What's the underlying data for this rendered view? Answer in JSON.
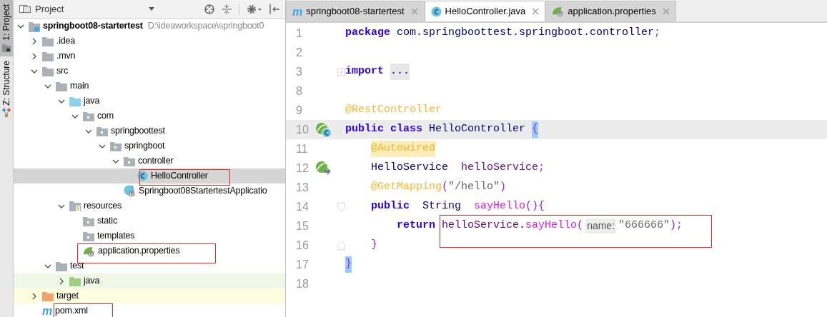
{
  "tool_strip": [
    {
      "label": "1: Project",
      "selected": true,
      "kind": "project"
    },
    {
      "label": "Z: Structure",
      "selected": false,
      "kind": "structure"
    }
  ],
  "project_panel": {
    "title": "Project",
    "tree": [
      {
        "label": "springboot08-startertest",
        "path": "D:\\ideaworkspace\\springboot0",
        "kind": "module",
        "expanded": true,
        "selected": false,
        "children": [
          {
            "label": ".idea",
            "kind": "folder",
            "expanded": false,
            "selected": false
          },
          {
            "label": ".mvn",
            "kind": "folder",
            "expanded": false,
            "selected": false
          },
          {
            "label": "src",
            "kind": "folder",
            "expanded": true,
            "selected": false,
            "children": [
              {
                "label": "main",
                "kind": "folder",
                "expanded": true,
                "selected": false,
                "children": [
                  {
                    "label": "java",
                    "kind": "source",
                    "expanded": true,
                    "selected": false,
                    "children": [
                      {
                        "label": "com",
                        "kind": "package",
                        "expanded": true,
                        "selected": false,
                        "children": [
                          {
                            "label": "springboottest",
                            "kind": "package",
                            "expanded": true,
                            "selected": false,
                            "children": [
                              {
                                "label": "springboot",
                                "kind": "package",
                                "expanded": true,
                                "selected": false,
                                "children": [
                                  {
                                    "label": "controller",
                                    "kind": "package",
                                    "expanded": true,
                                    "selected": false,
                                    "children": [
                                      {
                                        "label": "HelloController",
                                        "kind": "class",
                                        "selected": true
                                      }
                                    ]
                                  },
                                  {
                                    "label": "Springboot08StartertestApplicatio",
                                    "kind": "spring-class",
                                    "selected": false
                                  }
                                ]
                              }
                            ]
                          }
                        ]
                      }
                    ]
                  },
                  {
                    "label": "resources",
                    "kind": "resources",
                    "expanded": true,
                    "selected": false,
                    "children": [
                      {
                        "label": "static",
                        "kind": "package",
                        "selected": false
                      },
                      {
                        "label": "templates",
                        "kind": "package",
                        "selected": false
                      },
                      {
                        "label": "application.properties",
                        "kind": "properties",
                        "selected": false
                      }
                    ]
                  }
                ]
              },
              {
                "label": "test",
                "kind": "folder",
                "expanded": true,
                "selected": false,
                "children": [
                  {
                    "label": "java",
                    "kind": "test-source",
                    "expanded": false,
                    "selected": false
                  }
                ]
              }
            ]
          },
          {
            "label": "target",
            "kind": "excluded",
            "expanded": false,
            "selected": false
          },
          {
            "label": "pom.xml",
            "kind": "maven",
            "icon": "m",
            "selected": false
          }
        ]
      }
    ]
  },
  "editor": {
    "tabs": [
      {
        "label": "springboot08-startertest",
        "kind": "maven",
        "icon": "m",
        "selected": false
      },
      {
        "label": "HelloController.java",
        "kind": "class",
        "selected": true
      },
      {
        "label": "application.properties",
        "kind": "properties",
        "selected": false
      }
    ],
    "lines": [
      {
        "number": "1",
        "current": false,
        "tokens": [
          {
            "text": "package",
            "kind": "keyword"
          },
          {
            "text": " com.springboottest.springboot.controller",
            "kind": "plain"
          },
          {
            "text": ";",
            "kind": "punct"
          }
        ]
      },
      {
        "number": "2",
        "current": false
      },
      {
        "number": "3",
        "current": false,
        "fold": {
          "kind": "collapsed"
        },
        "tokens": [
          {
            "text": "import",
            "kind": "keyword"
          },
          {
            "text": " ...",
            "kind": "folded"
          }
        ]
      },
      {
        "number": "8",
        "current": false
      },
      {
        "number": "9",
        "current": false,
        "tokens": [
          {
            "text": "@RestController",
            "kind": "annotation"
          }
        ]
      },
      {
        "number": "10",
        "current": true,
        "gutter": {
          "kind": "bean-class"
        },
        "tokens": [
          {
            "text": "public class",
            "kind": "keyword"
          },
          {
            "text": " HelloController ",
            "kind": "plain"
          },
          {
            "text": "{",
            "kind": "brace-match"
          }
        ]
      },
      {
        "number": "11",
        "current": false,
        "tokens": [
          {
            "text": "    @Autowired",
            "kind": "annotation-marked"
          }
        ]
      },
      {
        "number": "12",
        "current": false,
        "gutter": {
          "kind": "autowired"
        },
        "tokens": [
          {
            "text": "    HelloService  ",
            "kind": "plain"
          },
          {
            "text": "helloService",
            "kind": "field"
          },
          {
            "text": ";",
            "kind": "punct"
          }
        ]
      },
      {
        "number": "13",
        "current": false,
        "tokens": [
          {
            "text": "    @GetMapping",
            "kind": "annotation"
          },
          {
            "text": "(",
            "kind": "punct"
          },
          {
            "text": "\"/hello\"",
            "kind": "string"
          },
          {
            "text": ")",
            "kind": "punct"
          }
        ]
      },
      {
        "number": "14",
        "current": false,
        "fold": {
          "kind": "start"
        },
        "tokens": [
          {
            "text": "    public",
            "kind": "keyword"
          },
          {
            "text": "  String  ",
            "kind": "plain"
          },
          {
            "text": "sayHello",
            "kind": "method"
          },
          {
            "text": "(){",
            "kind": "punct"
          }
        ]
      },
      {
        "number": "15",
        "current": false,
        "tokens": [
          {
            "text": "        return",
            "kind": "keyword"
          },
          {
            "text": " helloService",
            "kind": "field"
          },
          {
            "text": ".",
            "kind": "plain"
          },
          {
            "text": "sayHello",
            "kind": "method"
          },
          {
            "text": "(",
            "kind": "punct"
          },
          {
            "text": "name:",
            "kind": "param-hint"
          },
          {
            "text": "\"666666\"",
            "kind": "string"
          },
          {
            "text": ");",
            "kind": "punct"
          }
        ]
      },
      {
        "number": "16",
        "current": false,
        "fold": {
          "kind": "end"
        },
        "tokens": [
          {
            "text": "    }",
            "kind": "punct"
          }
        ]
      },
      {
        "number": "17",
        "current": false,
        "tokens": [
          {
            "text": "}",
            "kind": "brace-match"
          }
        ]
      },
      {
        "number": "18",
        "current": false
      }
    ]
  }
}
